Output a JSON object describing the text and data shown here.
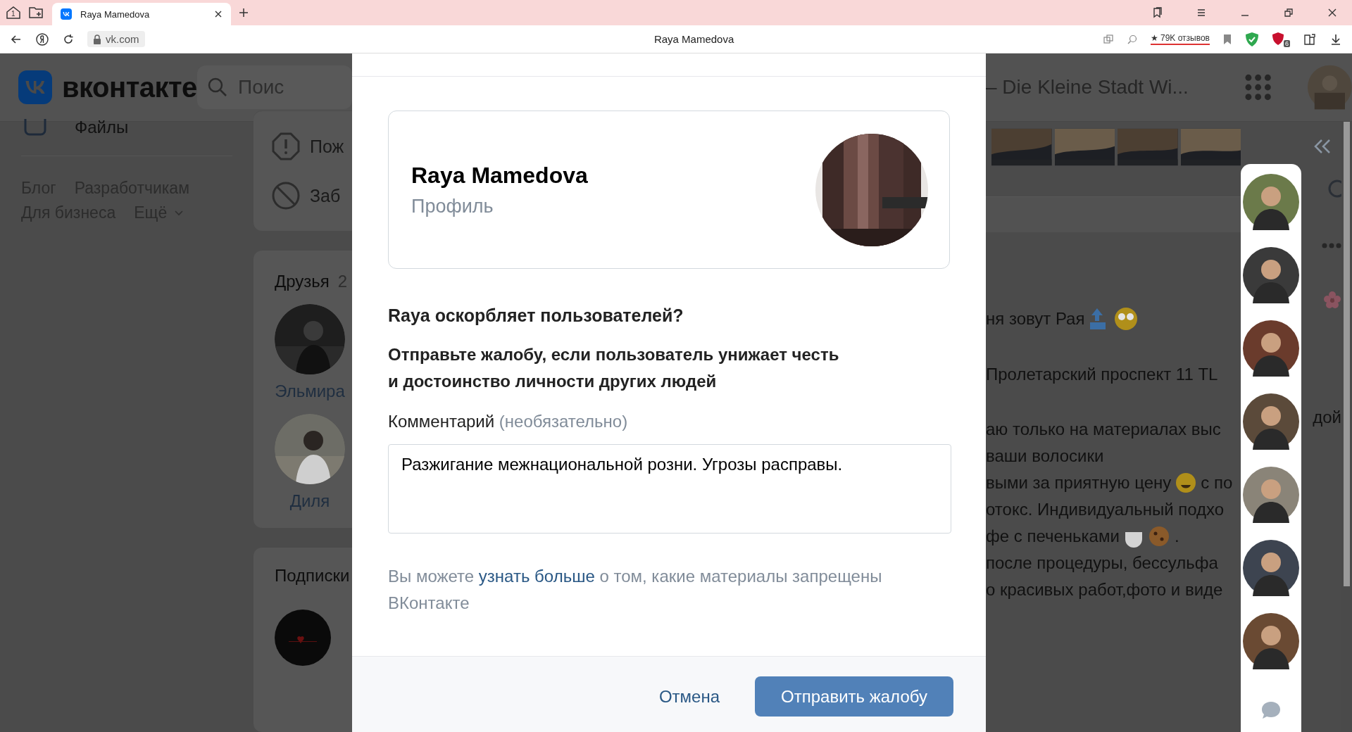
{
  "browser": {
    "tab_title": "Raya Mamedova",
    "home_badge": "1",
    "address": "vk.com",
    "page_title": "Raya Mamedova",
    "reviews": "★ 79K отзывов",
    "extension_badge": "6"
  },
  "page": {
    "logo": "вконтакте",
    "search_placeholder": "Поис",
    "header_title": "– Die Kleine Stadt Wi...",
    "sidebar_item": "Файлы",
    "footer_links": [
      "Блог",
      "Разработчикам",
      "Для бизнеса",
      "Ещё"
    ],
    "actions": [
      {
        "kind": "report",
        "label": "Пож"
      },
      {
        "kind": "block",
        "label": "Заб"
      }
    ],
    "friends": {
      "title": "Друзья",
      "count": "2",
      "people": [
        {
          "name": "Эльмира",
          "kind": "picture"
        },
        {
          "name": "Диля",
          "kind": "picture"
        }
      ]
    },
    "subscriptions": {
      "title": "Подписки"
    },
    "post_lines": [
      {
        "text": "ня зовут Рая",
        "kind": "top"
      },
      {
        "text": "Пролетарский проспект 11 TL"
      },
      {
        "text": "аю только на материалах выс"
      },
      {
        "text": "ваши волосики"
      },
      {
        "text": "выми за приятную цену",
        "kind": "smile",
        "after": "с по"
      },
      {
        "text": "отокс. Индивидуальный подхо"
      },
      {
        "text": "фе с печеньками",
        "kind": "cookie",
        "after": "."
      },
      {
        "text": "после процедуры, бессульфа"
      },
      {
        "text": "о красивых работ,фото и виде"
      }
    ],
    "right_fragment": "дой"
  },
  "modal": {
    "profile": {
      "name": "Raya Mamedova",
      "subtitle": "Профиль"
    },
    "question": "Raya оскорбляет пользователей?",
    "description": "Отправьте жалобу, если пользователь унижает честь\nи достоинство личности других людей",
    "comment_label": "Комментарий",
    "comment_hint": "(необязательно)",
    "comment_value": "Разжигание межнациональной розни. Угрозы расправы.",
    "help_before": "Вы можете",
    "help_link": "узнать больше",
    "help_after": "о том, какие материалы запрещены ВКонтакте",
    "cancel": "Отмена",
    "submit": "Отправить жалобу"
  }
}
